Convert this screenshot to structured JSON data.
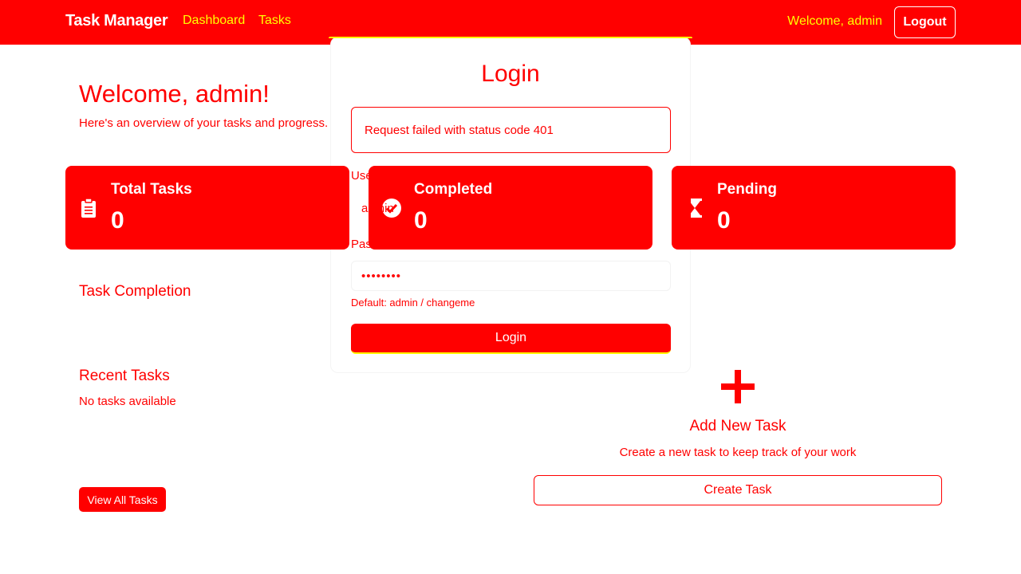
{
  "navbar": {
    "brand": "Task Manager",
    "links": [
      "Dashboard",
      "Tasks"
    ],
    "welcome": "Welcome, admin",
    "logout_label": "Logout"
  },
  "welcome": {
    "title": "Welcome, admin!",
    "subtitle": "Here's an overview of your tasks and progress."
  },
  "stats": [
    {
      "label": "Total Tasks",
      "value": "0",
      "icon": "clipboard-icon"
    },
    {
      "label": "Completed",
      "value": "0",
      "icon": "check-circle-icon"
    },
    {
      "label": "Pending",
      "value": "0",
      "icon": "hourglass-icon"
    }
  ],
  "sections": {
    "completion_title": "Task Completion",
    "recent_title": "Recent Tasks",
    "no_tasks": "No tasks available",
    "view_all_label": "View All Tasks"
  },
  "add_task": {
    "title": "Add New Task",
    "subtitle": "Create a new task to keep track of your work",
    "button_label": "Create Task"
  },
  "login_modal": {
    "title": "Login",
    "error": "Request failed with status code 401",
    "username_label": "Username",
    "username_value": "admin",
    "password_label": "Password",
    "password_value": "••••••••",
    "hint": "Default: admin / changeme",
    "submit_label": "Login"
  },
  "colors": {
    "primary": "#ff0000",
    "accent": "#ffff00",
    "background": "#ffffff"
  }
}
